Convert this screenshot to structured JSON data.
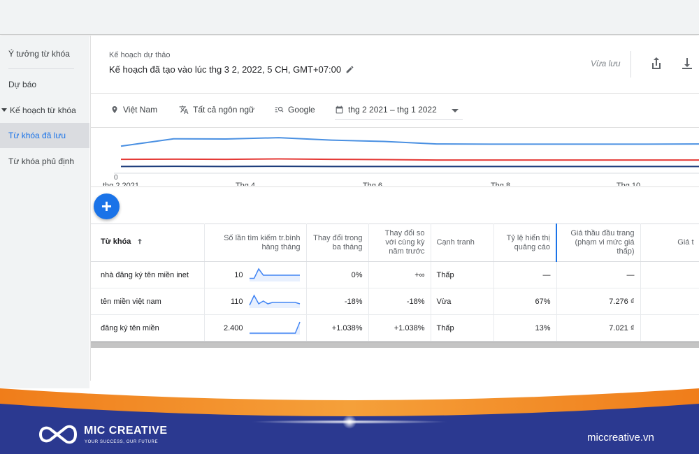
{
  "sidebar": {
    "items": [
      {
        "label": "Ý tưởng từ khóa"
      },
      {
        "label": "Dự báo"
      },
      {
        "label": "Kế hoạch từ khóa"
      },
      {
        "label": "Từ khóa đã lưu"
      },
      {
        "label": "Từ khóa phủ định"
      }
    ],
    "active_index": 3
  },
  "header": {
    "subtitle": "Kế hoạch dự thảo",
    "title": "Kế hoạch đã tạo vào lúc thg 3 2, 2022, 5 CH, GMT+07:00",
    "save_status": "Vừa lưu"
  },
  "filters": {
    "location": "Việt Nam",
    "language": "Tất cả ngôn ngữ",
    "network": "Google",
    "date_range": "thg 2 2021 – thg 1 2022"
  },
  "chart_data": {
    "type": "line",
    "x": [
      "thg 2 2021",
      "Thg 4",
      "Thg 6",
      "Thg 8",
      "Thg 10"
    ],
    "y_tick": "0",
    "series": [
      {
        "color": "#4a90e2",
        "values": [
          12.1,
          15.4,
          15.3,
          15.9,
          14.8,
          14.2,
          13.1,
          13.0,
          13.0,
          13.0,
          13.0,
          13.1
        ]
      },
      {
        "color": "#e53935",
        "values": [
          6.2,
          6.3,
          6.2,
          6.4,
          6.2,
          6.1,
          5.9,
          5.9,
          5.9,
          5.9,
          5.9,
          5.9
        ]
      },
      {
        "color": "#1a3a7a",
        "values": [
          3.0,
          3.1,
          3.0,
          3.1,
          3.0,
          3.0,
          3.0,
          3.0,
          3.0,
          3.0,
          3.0,
          3.0
        ]
      }
    ]
  },
  "table": {
    "headers": [
      "Từ khóa",
      "Số lần tìm kiếm tr.bình hàng tháng",
      "Thay đổi trong ba tháng",
      "Thay đổi so với cùng kỳ năm trước",
      "Cạnh tranh",
      "Tỷ lệ hiển thị quảng cáo",
      "Giá thầu đầu trang (phạm vi mức giá thấp)",
      "Giá t"
    ],
    "rows": [
      {
        "keyword": "nhà đăng ký tên miền inet",
        "volume": "10",
        "three_month": "0%",
        "yoy": "+∞",
        "competition": "Thấp",
        "impression_share": "—",
        "bid_low": "—",
        "bid_high": "",
        "trend": [
          2,
          2,
          8,
          4,
          4,
          4,
          4,
          4,
          4,
          4,
          4,
          4
        ]
      },
      {
        "keyword": "tên miền việt nam",
        "volume": "110",
        "three_month": "-18%",
        "yoy": "-18%",
        "competition": "Vừa",
        "impression_share": "67%",
        "bid_low": "7.276 ₫",
        "bid_high": "",
        "trend": [
          2,
          9,
          3,
          5,
          3,
          4,
          4,
          4,
          4,
          4,
          4,
          3
        ]
      },
      {
        "keyword": "đăng ký tên miền",
        "volume": "2.400",
        "three_month": "+1.038%",
        "yoy": "+1.038%",
        "competition": "Thấp",
        "impression_share": "13%",
        "bid_low": "7.021 ₫",
        "bid_high": "",
        "trend": [
          1,
          1,
          1,
          1,
          1,
          1,
          1,
          1,
          1,
          1,
          1,
          9
        ]
      }
    ]
  },
  "footer": {
    "brand": "MIC CREATIVE",
    "tagline": "YOUR SUCCESS, OUR FUTURE",
    "website": "miccreative.vn"
  },
  "colors": {
    "accent": "#1a73e8",
    "sidebar_bg": "#f1f3f4",
    "footer_navy": "#2a3a8a",
    "footer_orange": "#f28c1e"
  }
}
